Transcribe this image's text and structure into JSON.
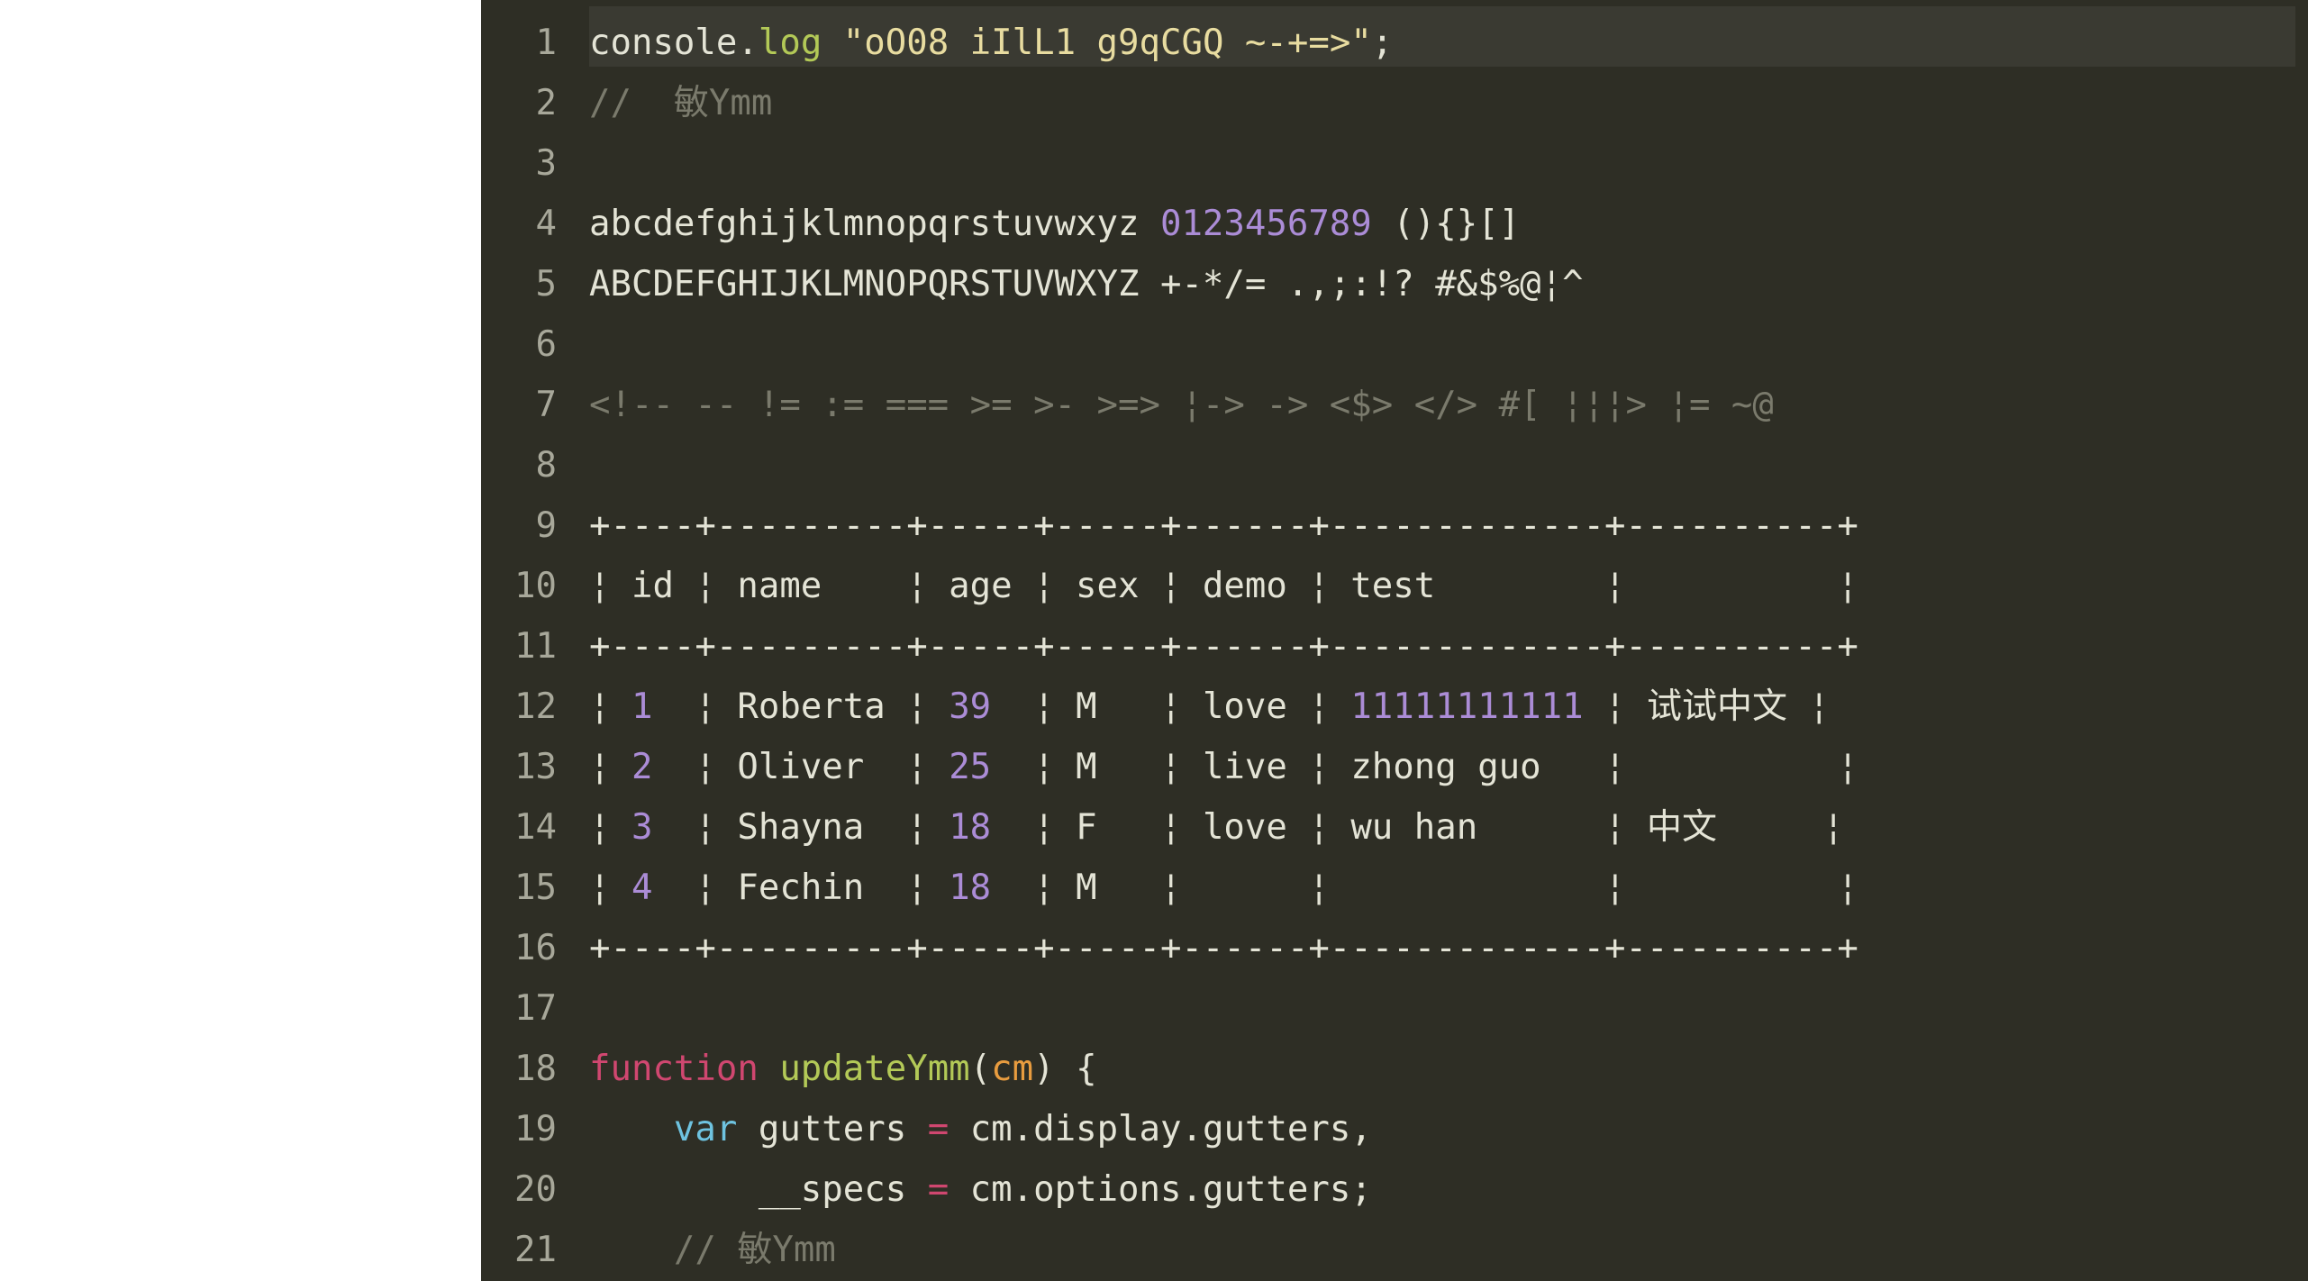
{
  "editor": {
    "lineNumbers": [
      "1",
      "2",
      "3",
      "4",
      "5",
      "6",
      "7",
      "8",
      "9",
      "10",
      "11",
      "12",
      "13",
      "14",
      "15",
      "16",
      "17",
      "18",
      "19",
      "20",
      "21"
    ],
    "lines": {
      "l1": {
        "console": "console",
        "dot1": ".",
        "log": "log",
        "space": " ",
        "string": "\"oO08 iIlL1 g9qCGQ ~-+=>\"",
        "semi": ";"
      },
      "l2": {
        "comment": "//  敏Ymm"
      },
      "l3": "",
      "l4": {
        "alpha": "abcdefghijklmnopqrstuvwxyz ",
        "digits": "0123456789",
        "brackets": " (){}[]"
      },
      "l5": {
        "text": "ABCDEFGHIJKLMNOPQRSTUVWXYZ +-*/= .,;:!? #&$%@¦^"
      },
      "l6": "",
      "l7": {
        "comment": "<!-- -- != := === >= >- >=> ¦-> -> <$> </> #[ ¦¦¦> ¦= ~@"
      },
      "l8": "",
      "l9": {
        "text": "+----+---------+-----+-----+------+-------------+----------+"
      },
      "l10": {
        "text": "¦ id ¦ name    ¦ age ¦ sex ¦ demo ¦ test        ¦          ¦"
      },
      "l11": {
        "text": "+----+---------+-----+-----+------+-------------+----------+"
      },
      "l12": {
        "p1": "¦ ",
        "id": "1",
        "p2": "  ¦ Roberta ¦ ",
        "age": "39",
        "p3": "  ¦ M   ¦ love ¦ ",
        "test": "11111111111",
        "p4": " ¦ 试试中文 ¦"
      },
      "l13": {
        "p1": "¦ ",
        "id": "2",
        "p2": "  ¦ Oliver  ¦ ",
        "age": "25",
        "p3": "  ¦ M   ¦ live ¦ zhong guo   ¦          ¦"
      },
      "l14": {
        "p1": "¦ ",
        "id": "3",
        "p2": "  ¦ Shayna  ¦ ",
        "age": "18",
        "p3": "  ¦ F   ¦ love ¦ wu han      ¦ 中文     ¦"
      },
      "l15": {
        "p1": "¦ ",
        "id": "4",
        "p2": "  ¦ Fechin  ¦ ",
        "age": "18",
        "p3": "  ¦ M   ¦      ¦             ¦          ¦"
      },
      "l16": {
        "text": "+----+---------+-----+-----+------+-------------+----------+"
      },
      "l17": "",
      "l18": {
        "function": "function",
        "sp1": " ",
        "name": "updateYmm",
        "open": "(",
        "param": "cm",
        "close": ")",
        "sp2": " ",
        "brace": "{"
      },
      "l19": {
        "indent": "    ",
        "var": "var",
        "sp1": " ",
        "gutters": "gutters",
        "sp2": " ",
        "eq": "=",
        "sp3": " ",
        "cm": "cm",
        "dot1": ".",
        "display": "display",
        "dot2": ".",
        "gutters2": "gutters",
        "comma": ","
      },
      "l20": {
        "indent": "        ",
        "specs": "__specs",
        "sp1": " ",
        "eq": "=",
        "sp2": " ",
        "cm": "cm",
        "dot1": ".",
        "options": "options",
        "dot2": ".",
        "gutters": "gutters",
        "semi": ";"
      },
      "l21": {
        "indent": "    ",
        "comment": "// 敏Ymm"
      }
    }
  }
}
